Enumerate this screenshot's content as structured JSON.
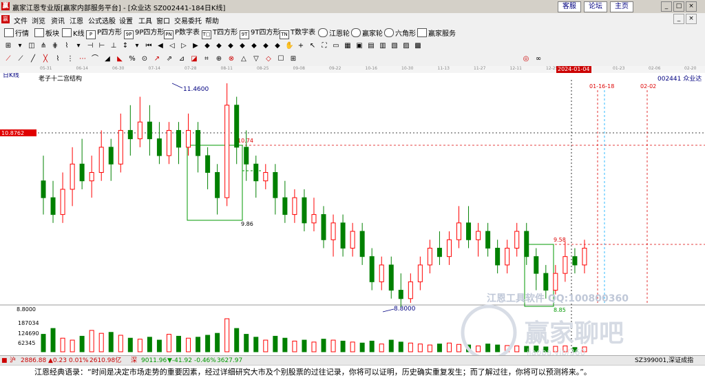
{
  "window": {
    "title": "赢家江恩专业版[赢家内部服务平台] - [众业达  SZ002441-184日K线]",
    "links": [
      "客服",
      "论坛",
      "主页"
    ],
    "controls": [
      "_",
      "□",
      "×"
    ]
  },
  "menu": [
    "文件",
    "浏览",
    "资讯",
    "江恩",
    "公式选股",
    "设置",
    "工具",
    "窗口",
    "交易委托",
    "帮助"
  ],
  "toolbar": [
    "行情",
    "板块",
    "K线",
    "P四方形",
    "9P四方形",
    "P数字表",
    "T四方形",
    "9T四方形",
    "T数字表",
    "江恩轮",
    "赢家轮",
    "六角形",
    "赢家服务"
  ],
  "toolbar_icons": [
    "P",
    "9P",
    "PN",
    "T□",
    "9T",
    "TN"
  ],
  "dates": [
    "05-31",
    "06-14",
    "06-30",
    "07-14",
    "07-28",
    "08-11",
    "08-25",
    "09-08",
    "09-22",
    "10-16",
    "10-30",
    "11-13",
    "11-27",
    "12-11",
    "12-25",
    "2024-01-04",
    "01-23",
    "02-06",
    "02-20"
  ],
  "chart": {
    "period_label": "日K线",
    "study_label": "老子十二宫结构",
    "stock_label": "002441 众业达",
    "price_tag": "10.8762",
    "annot": {
      "high": "11.4600",
      "low": "8.8000",
      "box1_top": "10.74",
      "box1_bottom": "9.86",
      "box2_top": "9.58",
      "box2_bottom": "8.85",
      "date1": "01-16-18",
      "date2": "02-02",
      "floor": "8.8000"
    },
    "volume_labels": [
      "187034",
      "124690",
      "62345"
    ],
    "watermark1": "江恩工具软件  QQ:100800360",
    "watermark2": "赢家聊吧",
    "watermark3": "iiaoba.vip/360"
  },
  "chart_data": {
    "type": "candlestick",
    "ylim": [
      8.8,
      11.46
    ],
    "values": [
      [
        10.3,
        10.1,
        10.6,
        9.9
      ],
      [
        10.1,
        9.9,
        10.3,
        9.8
      ],
      [
        9.9,
        10.2,
        10.4,
        9.8
      ],
      [
        10.2,
        10.5,
        10.7,
        10.0
      ],
      [
        10.5,
        10.3,
        10.8,
        10.2
      ],
      [
        10.3,
        10.4,
        10.6,
        10.1
      ],
      [
        10.4,
        10.7,
        10.9,
        10.3
      ],
      [
        10.7,
        10.5,
        10.8,
        10.3
      ],
      [
        10.5,
        10.9,
        11.1,
        10.4
      ],
      [
        10.9,
        10.8,
        11.2,
        10.6
      ],
      [
        10.8,
        11.0,
        11.3,
        10.7
      ],
      [
        11.0,
        10.8,
        11.2,
        10.6
      ],
      [
        10.8,
        10.6,
        11.0,
        10.5
      ],
      [
        10.6,
        10.9,
        11.0,
        10.5
      ],
      [
        10.9,
        10.7,
        11.0,
        10.5
      ],
      [
        10.7,
        10.9,
        11.1,
        10.6
      ],
      [
        10.9,
        10.6,
        11.0,
        10.4
      ],
      [
        10.6,
        10.4,
        10.7,
        10.2
      ],
      [
        10.4,
        10.1,
        10.5,
        9.9
      ],
      [
        10.1,
        11.2,
        11.46,
        10.0
      ],
      [
        11.2,
        10.7,
        11.3,
        10.5
      ],
      [
        10.7,
        10.5,
        10.9,
        10.3
      ],
      [
        10.5,
        10.3,
        10.6,
        10.1
      ],
      [
        10.3,
        10.4,
        10.5,
        10.2
      ],
      [
        10.4,
        10.1,
        10.5,
        9.9
      ],
      [
        10.1,
        9.9,
        10.3,
        9.8
      ],
      [
        9.9,
        10.1,
        10.2,
        9.8
      ],
      [
        10.1,
        9.8,
        10.2,
        9.7
      ],
      [
        9.8,
        9.9,
        10.1,
        9.7
      ],
      [
        9.9,
        9.6,
        10.0,
        9.5
      ],
      [
        9.6,
        9.8,
        9.9,
        9.4
      ],
      [
        9.8,
        9.5,
        9.9,
        9.4
      ],
      [
        9.5,
        9.7,
        9.8,
        9.4
      ],
      [
        9.7,
        9.4,
        9.8,
        9.3
      ],
      [
        9.4,
        9.1,
        9.5,
        9.0
      ],
      [
        9.1,
        9.3,
        9.4,
        9.0
      ],
      [
        9.3,
        9.0,
        9.4,
        8.9
      ],
      [
        9.0,
        8.9,
        9.2,
        8.8
      ],
      [
        8.9,
        9.1,
        9.2,
        8.85
      ],
      [
        9.1,
        9.3,
        9.4,
        9.0
      ],
      [
        9.3,
        9.5,
        9.6,
        9.2
      ],
      [
        9.5,
        9.4,
        9.7,
        9.3
      ],
      [
        9.4,
        9.6,
        9.7,
        9.3
      ],
      [
        9.6,
        9.8,
        10.0,
        9.5
      ],
      [
        9.8,
        9.6,
        10.0,
        9.5
      ],
      [
        9.6,
        9.7,
        9.8,
        9.4
      ],
      [
        9.7,
        9.5,
        9.8,
        9.4
      ],
      [
        9.5,
        9.3,
        9.6,
        9.2
      ],
      [
        9.3,
        9.5,
        9.6,
        9.2
      ],
      [
        9.5,
        9.7,
        9.8,
        9.4
      ],
      [
        9.7,
        9.4,
        9.8,
        9.3
      ],
      [
        9.4,
        9.2,
        9.5,
        9.0
      ],
      [
        9.2,
        9.0,
        9.3,
        8.9
      ],
      [
        9.0,
        9.2,
        9.3,
        8.95
      ],
      [
        9.2,
        9.4,
        9.58,
        9.1
      ],
      [
        9.4,
        9.3,
        9.5,
        9.2
      ],
      [
        9.3,
        9.5,
        9.6,
        9.2
      ]
    ],
    "volume": [
      90,
      120,
      70,
      60,
      80,
      110,
      95,
      100,
      85,
      70,
      65,
      75,
      60,
      90,
      80,
      70,
      75,
      85,
      95,
      170,
      120,
      90,
      75,
      60,
      80,
      70,
      55,
      60,
      50,
      65,
      60,
      55,
      50,
      45,
      55,
      40,
      60,
      50,
      45,
      40,
      35,
      40,
      45,
      38,
      35,
      30,
      40,
      35,
      32,
      30,
      28,
      30,
      25,
      28,
      30,
      22,
      25
    ]
  },
  "ticker": {
    "sh": "2886.88",
    "sh_chg": "▲0.23",
    "sh_pct": "0.01%",
    "sh_amt": "2610.98亿",
    "sz": "9011.96",
    "sz_chg": "▼-41.92",
    "sz_pct": "-0.46%",
    "sz_amt": "3627.97",
    "right": "SZ399001,深证成指"
  },
  "footer": "江恩经典语录：“时间是决定市场走势的重要因素，经过详细研究大市及个别股票的过往记录，你将可以证明，历史确实重复发生；而了解过往，你将可以预测将来。”。",
  "colors": {
    "up": "#ff0000",
    "down": "#008000",
    "accent": "#cc0000"
  }
}
